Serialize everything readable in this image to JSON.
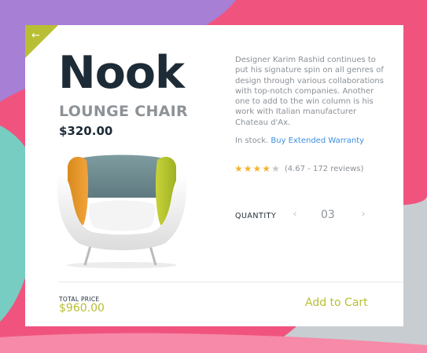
{
  "colors": {
    "accent": "#b8bf34",
    "title": "#1d2b36",
    "link": "#3c8fe0",
    "star_filled": "#f3b431",
    "star_empty": "#c3c7cb",
    "background_pink": "#f0547e",
    "background_purple": "#a77fd5",
    "background_teal": "#77cdc2",
    "background_grey": "#c8cdd1"
  },
  "nav": {
    "back_icon": "arrow-left-icon"
  },
  "product": {
    "title": "Nook",
    "subtitle": "LOUNGE CHAIR",
    "price": "$320.00",
    "description": "Designer Karim Rashid continues to put his signature spin on all genres of design through various collaborations with top-notch companies. Another one to add to the win column is his work with Italian manufacturer Chateau d'Ax."
  },
  "availability": {
    "status": "In stock.",
    "warranty_link": "Buy Extended Warranty"
  },
  "rating": {
    "stars_filled": 4,
    "stars_total": 5,
    "summary": "(4.67 - 172 reviews)"
  },
  "quantity": {
    "label": "QUANTITY",
    "value": "03",
    "prev_icon": "chevron-left-icon",
    "next_icon": "chevron-right-icon"
  },
  "footer": {
    "total_label": "TOTAL PRICE",
    "total_value": "$960.00",
    "add_to_cart": "Add to Cart"
  }
}
